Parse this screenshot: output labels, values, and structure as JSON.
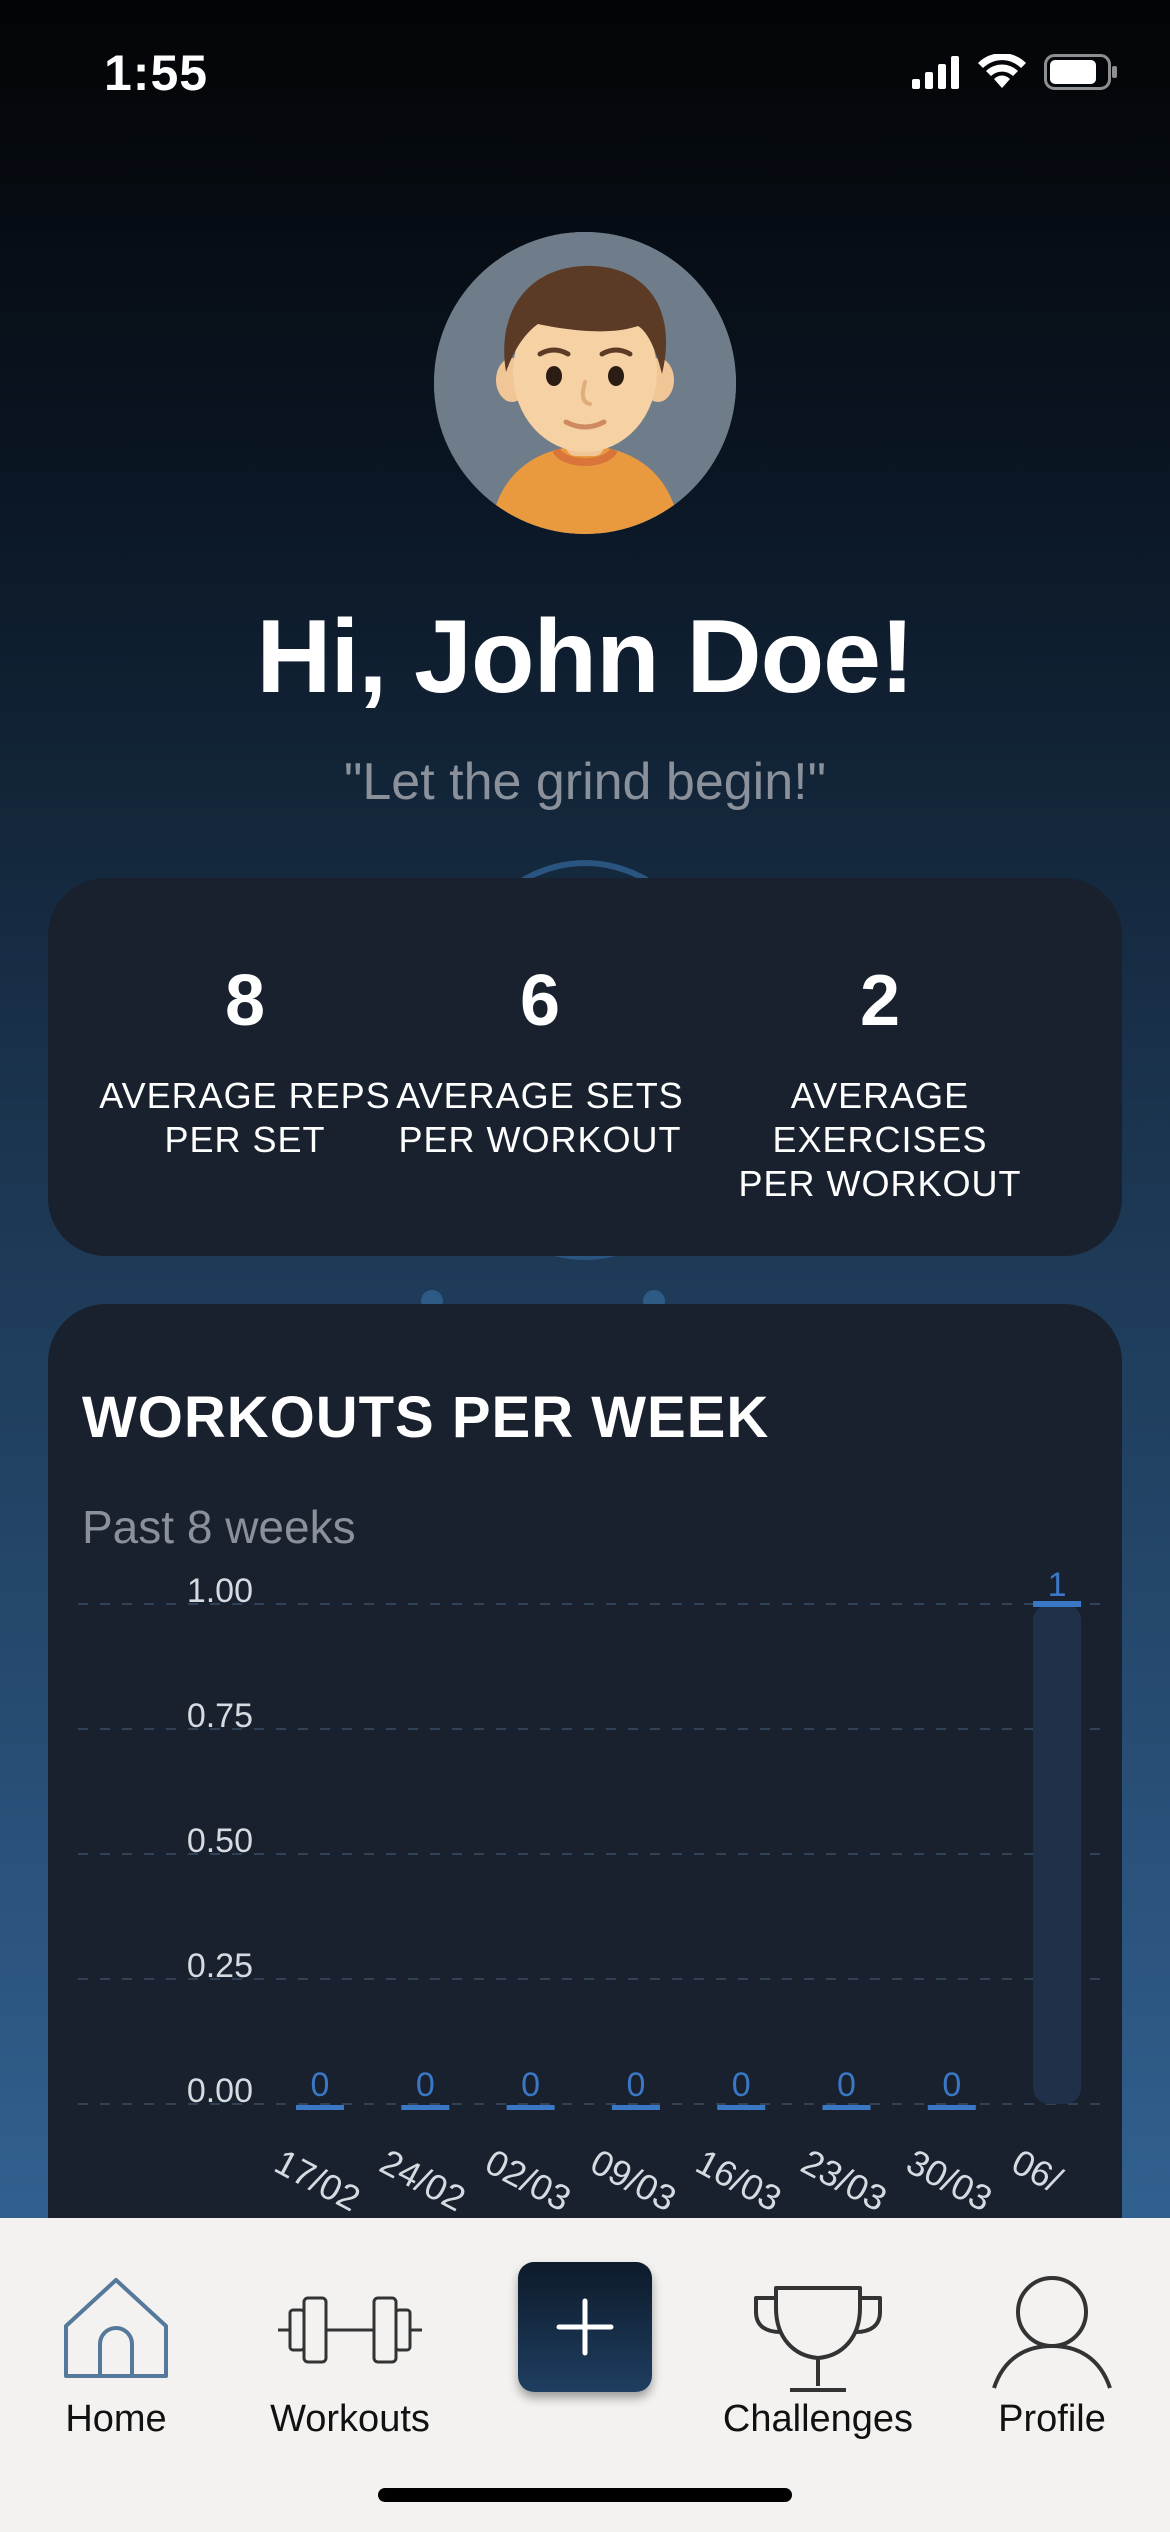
{
  "status_bar": {
    "time": "1:55"
  },
  "header": {
    "greeting": "Hi, John Doe!",
    "quote": "\"Let the grind begin!\""
  },
  "stats": [
    {
      "value": "8",
      "label_line1": "AVERAGE REPS",
      "label_line2": "PER SET"
    },
    {
      "value": "6",
      "label_line1": "AVERAGE SETS",
      "label_line2": "PER WORKOUT"
    },
    {
      "value": "2",
      "label_line1": "AVERAGE EXERCISES",
      "label_line2": "PER WORKOUT"
    }
  ],
  "chart_card": {
    "title": "WORKOUTS PER WEEK",
    "subtitle": "Past 8 weeks"
  },
  "chart_data": {
    "type": "bar",
    "title": "WORKOUTS PER WEEK",
    "subtitle": "Past 8 weeks",
    "categories": [
      "17/02",
      "24/02",
      "02/03",
      "09/03",
      "16/03",
      "23/03",
      "30/03",
      "06/"
    ],
    "values": [
      0,
      0,
      0,
      0,
      0,
      0,
      0,
      1
    ],
    "ylim": [
      0,
      1
    ],
    "yticks": [
      "0.00",
      "0.25",
      "0.50",
      "0.75",
      "1.00"
    ],
    "grid": true,
    "bar_color": "#3a77c4",
    "bar_track_color": "#1f3048"
  },
  "nav": {
    "items": [
      {
        "label": "Home",
        "icon": "home-icon"
      },
      {
        "label": "Workouts",
        "icon": "dumbbell-icon"
      },
      {
        "label": "Challenges",
        "icon": "trophy-icon"
      },
      {
        "label": "Profile",
        "icon": "person-icon"
      }
    ],
    "add_icon": "plus-icon"
  },
  "colors": {
    "accent": "#3a77c4",
    "card": "#18212d",
    "muted_text": "#8a919a",
    "tab_bar": "#f3f2f0"
  }
}
